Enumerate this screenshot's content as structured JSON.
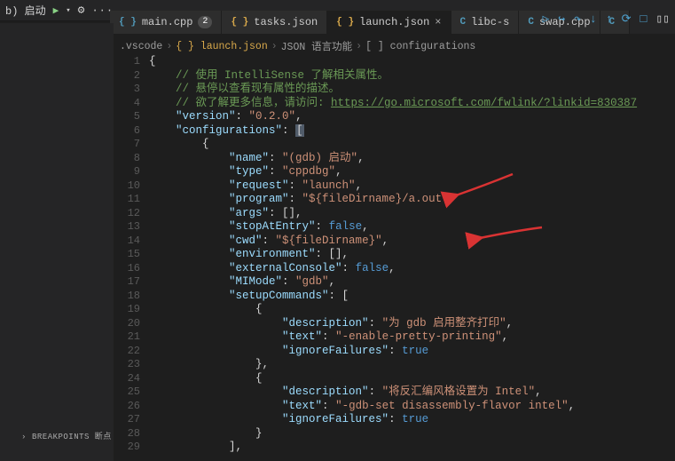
{
  "topbar": {
    "run_label": "b) 启动"
  },
  "tabs": [
    {
      "icon": "bracket-blue",
      "label": "main.cpp",
      "badge": "2",
      "active": false
    },
    {
      "icon": "bracket",
      "label": "tasks.json",
      "active": false
    },
    {
      "icon": "bracket",
      "label": "launch.json",
      "active": true,
      "close": true
    },
    {
      "icon": "c",
      "label": "libc-s",
      "active": false
    },
    {
      "icon": "c",
      "label": "swap.cpp",
      "active": false
    },
    {
      "icon": "c",
      "label": "",
      "active": false
    }
  ],
  "breadcrumb": {
    "parts": [
      ".vscode",
      "{ } launch.json",
      "JSON 语言功能",
      "[ ] configurations"
    ]
  },
  "sidebar": {
    "breakpoints_label": "BREAKPOINTS 断点"
  },
  "code_lines": [
    {
      "n": 1,
      "html": "<span class='c-brace'>{</span>"
    },
    {
      "n": 2,
      "html": "    <span class='c-comment'>// 使用 IntelliSense 了解相关属性。</span>"
    },
    {
      "n": 3,
      "html": "    <span class='c-comment'>// 悬停以查看现有属性的描述。</span>"
    },
    {
      "n": 4,
      "html": "    <span class='c-comment'>// 欲了解更多信息，请访问: </span><span class='c-link'>https://go.microsoft.com/fwlink/?linkid=830387</span>"
    },
    {
      "n": 5,
      "html": "    <span class='c-key'>\"version\"</span><span class='c-punc'>: </span><span class='c-string'>\"0.2.0\"</span><span class='c-punc'>,</span>"
    },
    {
      "n": 6,
      "html": "    <span class='c-key'>\"configurations\"</span><span class='c-punc'>: </span><span class='c-brkhl'>[</span>"
    },
    {
      "n": 7,
      "html": "        <span class='c-brace'>{</span>"
    },
    {
      "n": 8,
      "html": "            <span class='c-key'>\"name\"</span><span class='c-punc'>: </span><span class='c-string'>\"(gdb) 启动\"</span><span class='c-punc'>,</span>"
    },
    {
      "n": 9,
      "html": "            <span class='c-key'>\"type\"</span><span class='c-punc'>: </span><span class='c-string'>\"cppdbg\"</span><span class='c-punc'>,</span>"
    },
    {
      "n": 10,
      "html": "            <span class='c-key'>\"request\"</span><span class='c-punc'>: </span><span class='c-string'>\"launch\"</span><span class='c-punc'>,</span>"
    },
    {
      "n": 11,
      "html": "            <span class='c-key'>\"program\"</span><span class='c-punc'>: </span><span class='c-string'>\"${fileDirname}/a.out\"</span><span class='c-punc'>,</span>"
    },
    {
      "n": 12,
      "html": "            <span class='c-key'>\"args\"</span><span class='c-punc'>: [],</span>"
    },
    {
      "n": 13,
      "html": "            <span class='c-key'>\"stopAtEntry\"</span><span class='c-punc'>: </span><span class='c-bool'>false</span><span class='c-punc'>,</span>"
    },
    {
      "n": 14,
      "html": "            <span class='c-key'>\"cwd\"</span><span class='c-punc'>: </span><span class='c-string'>\"${fileDirname}\"</span><span class='c-punc'>,</span>"
    },
    {
      "n": 15,
      "html": "            <span class='c-key'>\"environment\"</span><span class='c-punc'>: [],</span>"
    },
    {
      "n": 16,
      "html": "            <span class='c-key'>\"externalConsole\"</span><span class='c-punc'>: </span><span class='c-bool'>false</span><span class='c-punc'>,</span>"
    },
    {
      "n": 17,
      "html": "            <span class='c-key'>\"MIMode\"</span><span class='c-punc'>: </span><span class='c-string'>\"gdb\"</span><span class='c-punc'>,</span>"
    },
    {
      "n": 18,
      "html": "            <span class='c-key'>\"setupCommands\"</span><span class='c-punc'>: [</span>"
    },
    {
      "n": 19,
      "html": "                <span class='c-brace'>{</span>"
    },
    {
      "n": 20,
      "html": "                    <span class='c-key'>\"description\"</span><span class='c-punc'>: </span><span class='c-string'>\"为 gdb 启用整齐打印\"</span><span class='c-punc'>,</span>"
    },
    {
      "n": 21,
      "html": "                    <span class='c-key'>\"text\"</span><span class='c-punc'>: </span><span class='c-string'>\"-enable-pretty-printing\"</span><span class='c-punc'>,</span>"
    },
    {
      "n": 22,
      "html": "                    <span class='c-key'>\"ignoreFailures\"</span><span class='c-punc'>: </span><span class='c-bool'>true</span>"
    },
    {
      "n": 23,
      "html": "                <span class='c-brace'>}</span><span class='c-punc'>,</span>"
    },
    {
      "n": 24,
      "html": "                <span class='c-brace'>{</span>"
    },
    {
      "n": 25,
      "html": "                    <span class='c-key'>\"description\"</span><span class='c-punc'>: </span><span class='c-string'>\"将反汇编风格设置为 Intel\"</span><span class='c-punc'>,</span>"
    },
    {
      "n": 26,
      "html": "                    <span class='c-key'>\"text\"</span><span class='c-punc'>: </span><span class='c-string'>\"-gdb-set disassembly-flavor intel\"</span><span class='c-punc'>,</span>"
    },
    {
      "n": 27,
      "html": "                    <span class='c-key'>\"ignoreFailures\"</span><span class='c-punc'>: </span><span class='c-bool'>true</span>"
    },
    {
      "n": 28,
      "html": "                <span class='c-brace'>}</span>"
    },
    {
      "n": 29,
      "html": "            <span class='c-punc'>],</span>"
    }
  ]
}
